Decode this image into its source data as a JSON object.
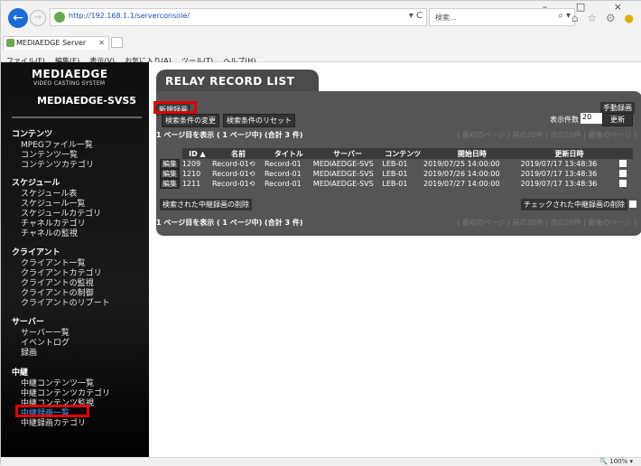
{
  "browser": {
    "url": "http://192.168.1.1/serverconsole/",
    "search_placeholder": "検索...",
    "tab_label": "MEDIAEDGE Server Console...",
    "menu": [
      "ファイル(F)",
      "編集(E)",
      "表示(V)",
      "お気に入り(A)",
      "ツール(T)",
      "ヘルプ(H)"
    ],
    "zoom": "100%"
  },
  "sidebar": {
    "brand": "MEDIAEDGE",
    "brand_sub": "VIDEO CASTING SYSTEM",
    "server": "MEDIAEDGE-SVS5",
    "groups": [
      {
        "title": "コンテンツ",
        "items": [
          "MPEGファイル一覧",
          "コンテンツ一覧",
          "コンテンツカテゴリ"
        ]
      },
      {
        "title": "スケジュール",
        "items": [
          "スケジュール表",
          "スケジュール一覧",
          "スケジュールカテゴリ",
          "チャネルカテゴリ",
          "チャネルの監視"
        ]
      },
      {
        "title": "クライアント",
        "items": [
          "クライアント一覧",
          "クライアントカテゴリ",
          "クライアントの監視",
          "クライアントの制御",
          "クライアントのリブート"
        ]
      },
      {
        "title": "サーバー",
        "items": [
          "サーバー一覧",
          "イベントログ",
          "録画"
        ]
      },
      {
        "title": "中継",
        "items": [
          "中継コンテンツ一覧",
          "中継コンテンツカテゴリ",
          "中継コンテンツ監視",
          "中継録画一覧",
          "中継録画カテゴリ"
        ]
      }
    ]
  },
  "main": {
    "title": "RELAY RECORD LIST",
    "new_button": "新規録画",
    "manual_button": "手動録画",
    "change_search": "検索条件の変更",
    "reset_search": "検索条件のリセット",
    "count_label": "表示件数",
    "count_value": "20",
    "update_button": "更新",
    "page_summary": "1 ページ目を表示 ( 1 ページ中) (合計 3 件)",
    "pager": "[ 最初のページ | 前の20件 | 次の20件 | 最後のページ ]",
    "columns": [
      "ID ▲",
      "名前",
      "タイトル",
      "サーバー",
      "コンテンツ",
      "開始日時",
      "更新日時"
    ],
    "rows": [
      {
        "edit": "編集",
        "id": "1209",
        "name": "Record-01",
        "title": "Record-01",
        "server": "MEDIAEDGE-SVS",
        "content": "LEB-01",
        "start": "2019/07/25 14:00:00",
        "updated": "2019/07/17 13:48:36"
      },
      {
        "edit": "編集",
        "id": "1210",
        "name": "Record-01",
        "title": "Record-01",
        "server": "MEDIAEDGE-SVS",
        "content": "LEB-01",
        "start": "2019/07/26 14:00:00",
        "updated": "2019/07/17 13:48:36"
      },
      {
        "edit": "編集",
        "id": "1211",
        "name": "Record-01",
        "title": "Record-01",
        "server": "MEDIAEDGE-SVS",
        "content": "LEB-01",
        "start": "2019/07/27 14:00:00",
        "updated": "2019/07/17 13:48:36"
      }
    ],
    "delete_found": "検索された中継録画の削除",
    "delete_checked": "チェックされた中継録画の削除"
  }
}
